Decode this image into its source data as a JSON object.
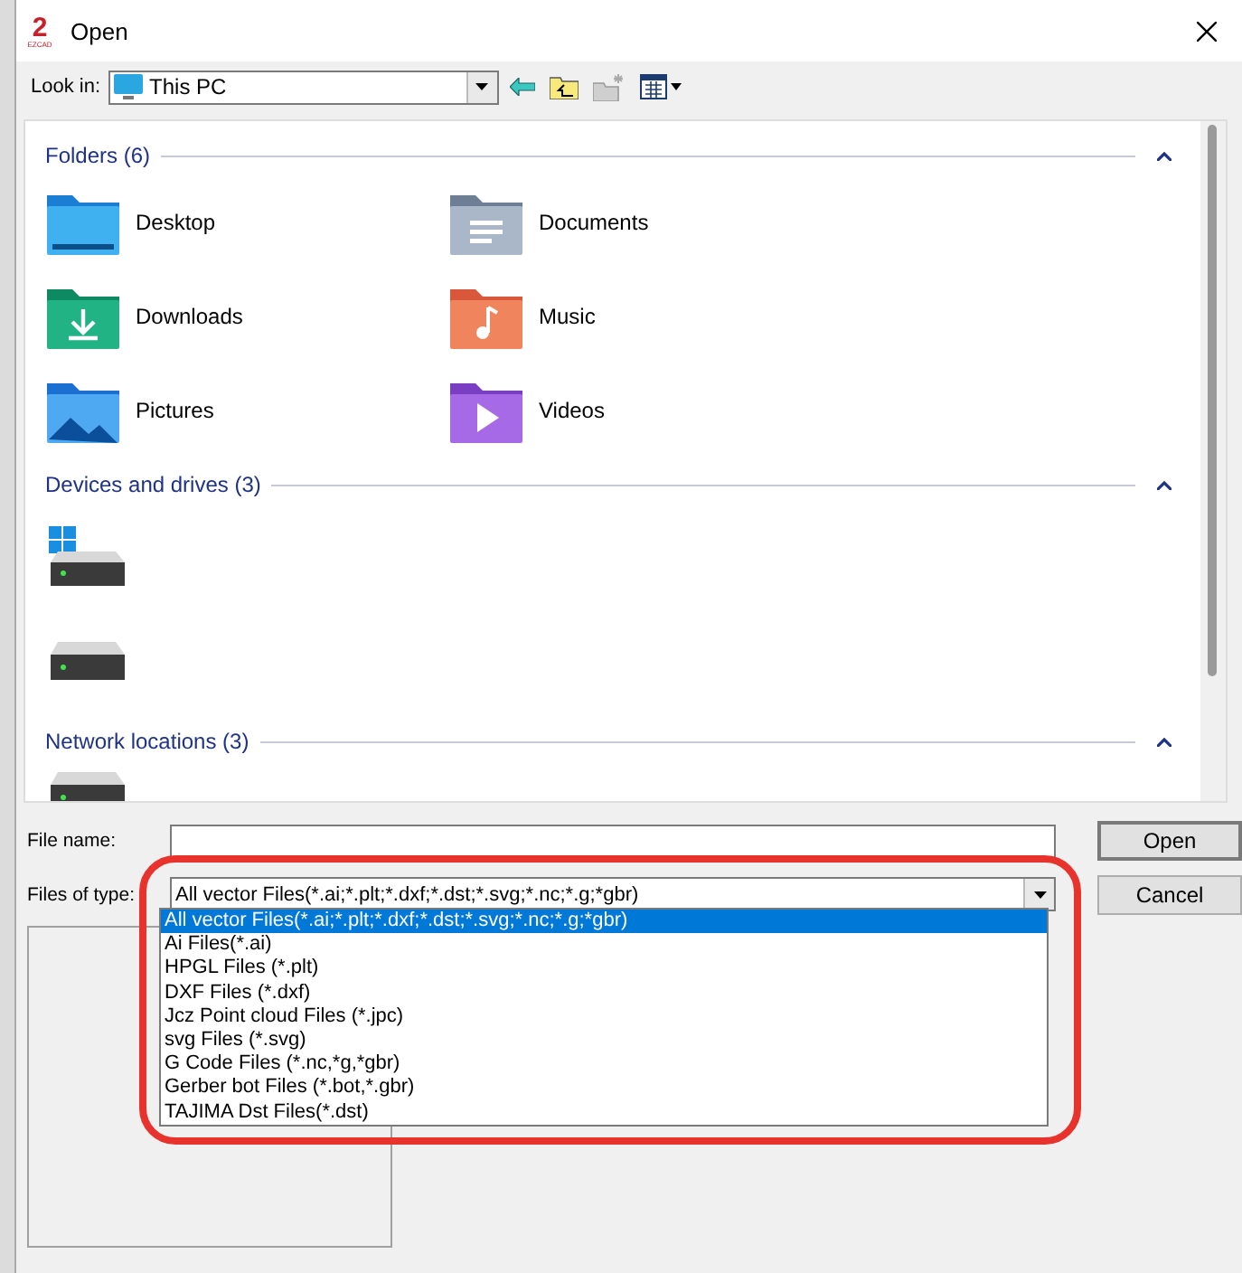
{
  "window": {
    "title": "Open",
    "logo": {
      "mark": "2",
      "caption": "EZCAD"
    }
  },
  "look_in": {
    "label": "Look in:",
    "value": "This PC"
  },
  "sections": [
    {
      "title": "Folders (6)",
      "expanded": true,
      "items": [
        {
          "kind": "desktop",
          "label": "Desktop"
        },
        {
          "kind": "documents",
          "label": "Documents"
        },
        {
          "kind": "downloads",
          "label": "Downloads"
        },
        {
          "kind": "music",
          "label": "Music"
        },
        {
          "kind": "pictures",
          "label": "Pictures"
        },
        {
          "kind": "videos",
          "label": "Videos"
        }
      ]
    },
    {
      "title": "Devices and drives (3)",
      "expanded": true,
      "items": [
        {
          "kind": "system-drive"
        },
        {
          "kind": "drive"
        }
      ]
    },
    {
      "title": "Network locations (3)",
      "expanded": true,
      "items": [
        {
          "kind": "network-drive"
        }
      ]
    }
  ],
  "file_name": {
    "label": "File name:"
  },
  "file_type": {
    "label": "Files of type:",
    "value": "All vector Files(*.ai;*.plt;*.dxf;*.dst;*.svg;*.nc;*.g;*gbr)"
  },
  "file_type_options": [
    {
      "label": "All vector Files(*.ai;*.plt;*.dxf;*.dst;*.svg;*.nc;*.g;*gbr)",
      "selected": true
    },
    {
      "label": "Ai Files(*.ai)",
      "selected": false
    },
    {
      "label": "HPGL Files (*.plt)",
      "selected": false
    },
    {
      "label": "DXF Files (*.dxf)",
      "selected": false
    },
    {
      "label": "Jcz Point cloud Files (*.jpc)",
      "selected": false
    },
    {
      "label": "svg Files (*.svg)",
      "selected": false
    },
    {
      "label": "G Code Files (*.nc,*g,*gbr)",
      "selected": false
    },
    {
      "label": "Gerber bot Files (*.bot,*.gbr)",
      "selected": false
    },
    {
      "label": "TAJIMA Dst Files(*.dst)",
      "selected": false
    }
  ],
  "buttons": [
    {
      "label": "Open",
      "default": true
    },
    {
      "label": "Cancel",
      "default": false
    }
  ]
}
